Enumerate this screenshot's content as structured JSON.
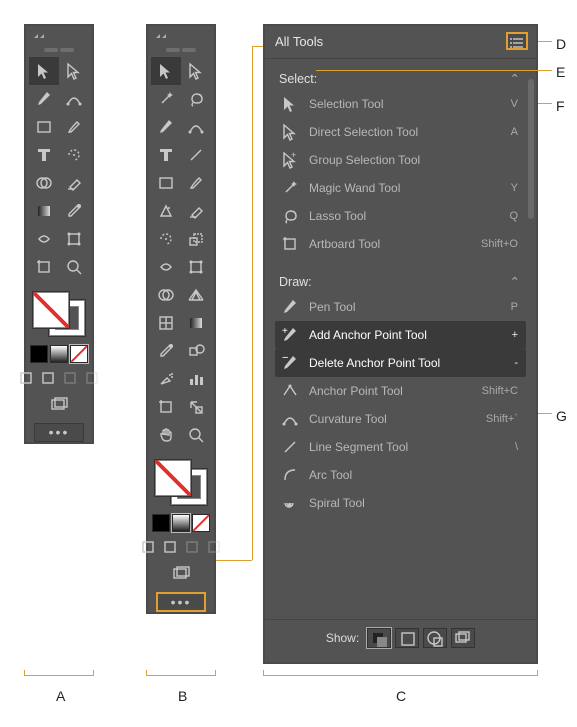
{
  "labels": {
    "A": "A",
    "B": "B",
    "C": "C",
    "D": "D",
    "E": "E",
    "F": "F",
    "G": "G"
  },
  "toolbarA": {
    "tools": [
      {
        "n": "selection"
      },
      {
        "n": "direct-selection"
      },
      {
        "n": "pen"
      },
      {
        "n": "curvature"
      },
      {
        "n": "rectangle"
      },
      {
        "n": "paintbrush"
      },
      {
        "n": "type"
      },
      {
        "n": "rotate"
      },
      {
        "n": "shape-builder"
      },
      {
        "n": "eraser"
      },
      {
        "n": "gradient"
      },
      {
        "n": "eyedropper"
      },
      {
        "n": "width"
      },
      {
        "n": "free-transform"
      },
      {
        "n": "artboard"
      },
      {
        "n": "zoom"
      }
    ],
    "mini": [
      {
        "n": "color-fill",
        "sel": false
      },
      {
        "n": "gradient-fill",
        "sel": false
      },
      {
        "n": "none-fill",
        "sel": true
      }
    ],
    "modes": [
      {
        "n": "draw-normal",
        "off": false
      },
      {
        "n": "draw-behind",
        "off": false
      },
      {
        "n": "draw-inside",
        "off": true
      },
      {
        "n": "draw-mode-4",
        "off": true
      }
    ],
    "ellipsis": "•••"
  },
  "toolbarB": {
    "tools": [
      {
        "n": "selection"
      },
      {
        "n": "direct-selection"
      },
      {
        "n": "magic-wand"
      },
      {
        "n": "lasso"
      },
      {
        "n": "pen"
      },
      {
        "n": "curvature"
      },
      {
        "n": "type"
      },
      {
        "n": "line-segment"
      },
      {
        "n": "rectangle"
      },
      {
        "n": "paintbrush"
      },
      {
        "n": "shaper"
      },
      {
        "n": "eraser"
      },
      {
        "n": "rotate"
      },
      {
        "n": "scale"
      },
      {
        "n": "width"
      },
      {
        "n": "free-transform"
      },
      {
        "n": "shape-builder"
      },
      {
        "n": "perspective-grid"
      },
      {
        "n": "mesh"
      },
      {
        "n": "gradient"
      },
      {
        "n": "eyedropper"
      },
      {
        "n": "blend"
      },
      {
        "n": "symbol-sprayer"
      },
      {
        "n": "column-graph"
      },
      {
        "n": "artboard"
      },
      {
        "n": "slice"
      },
      {
        "n": "hand"
      },
      {
        "n": "zoom"
      }
    ],
    "mini": [
      {
        "n": "color-fill",
        "sel": false
      },
      {
        "n": "gradient-fill",
        "sel": true
      },
      {
        "n": "none-fill",
        "sel": false
      }
    ],
    "modes": [
      {
        "n": "draw-normal",
        "off": false
      },
      {
        "n": "draw-behind",
        "off": false
      },
      {
        "n": "draw-inside",
        "off": true
      },
      {
        "n": "draw-mode-4",
        "off": true
      }
    ],
    "ellipsis": "•••"
  },
  "allTools": {
    "title": "All Tools",
    "menuIcon": "list-icon",
    "showLabel": "Show:",
    "showOptions": [
      {
        "n": "show-all"
      },
      {
        "n": "show-outline"
      },
      {
        "n": "show-grouped"
      },
      {
        "n": "show-stacked"
      }
    ],
    "categories": [
      {
        "name": "Select:",
        "items": [
          {
            "icon": "selection",
            "label": "Selection Tool",
            "key": "V"
          },
          {
            "icon": "direct-selection",
            "label": "Direct Selection Tool",
            "key": "A"
          },
          {
            "icon": "group-selection",
            "label": "Group Selection Tool",
            "key": ""
          },
          {
            "icon": "magic-wand",
            "label": "Magic Wand Tool",
            "key": "Y"
          },
          {
            "icon": "lasso",
            "label": "Lasso Tool",
            "key": "Q"
          },
          {
            "icon": "artboard",
            "label": "Artboard Tool",
            "key": "Shift+O"
          }
        ]
      },
      {
        "name": "Draw:",
        "items": [
          {
            "icon": "pen",
            "label": "Pen Tool",
            "key": "P"
          },
          {
            "icon": "add-anchor",
            "label": "Add Anchor Point Tool",
            "key": "+",
            "active": true
          },
          {
            "icon": "del-anchor",
            "label": "Delete Anchor Point Tool",
            "key": "-",
            "active": true
          },
          {
            "icon": "anchor-point",
            "label": "Anchor Point Tool",
            "key": "Shift+C"
          },
          {
            "icon": "curvature",
            "label": "Curvature Tool",
            "key": "Shift+`"
          },
          {
            "icon": "line",
            "label": "Line Segment Tool",
            "key": "\\"
          },
          {
            "icon": "arc",
            "label": "Arc Tool",
            "key": ""
          },
          {
            "icon": "spiral",
            "label": "Spiral Tool",
            "key": ""
          }
        ]
      }
    ]
  }
}
